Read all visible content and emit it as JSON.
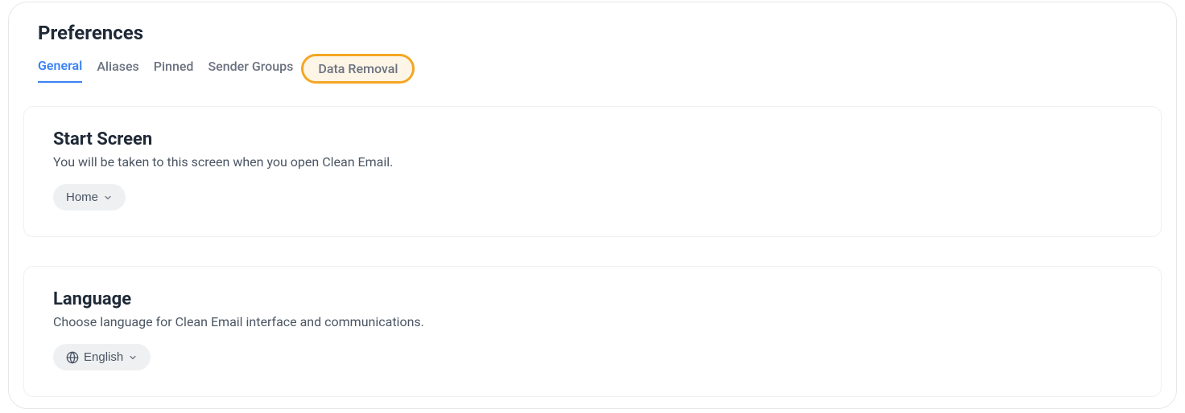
{
  "page": {
    "title": "Preferences"
  },
  "tabs": {
    "items": [
      {
        "label": "General"
      },
      {
        "label": "Aliases"
      },
      {
        "label": "Pinned"
      },
      {
        "label": "Sender Groups"
      },
      {
        "label": "Data Removal"
      }
    ]
  },
  "startScreen": {
    "title": "Start Screen",
    "description": "You will be taken to this screen when you open Clean Email.",
    "selected": "Home"
  },
  "language": {
    "title": "Language",
    "description": "Choose language for Clean Email interface and communications.",
    "selected": "English"
  }
}
